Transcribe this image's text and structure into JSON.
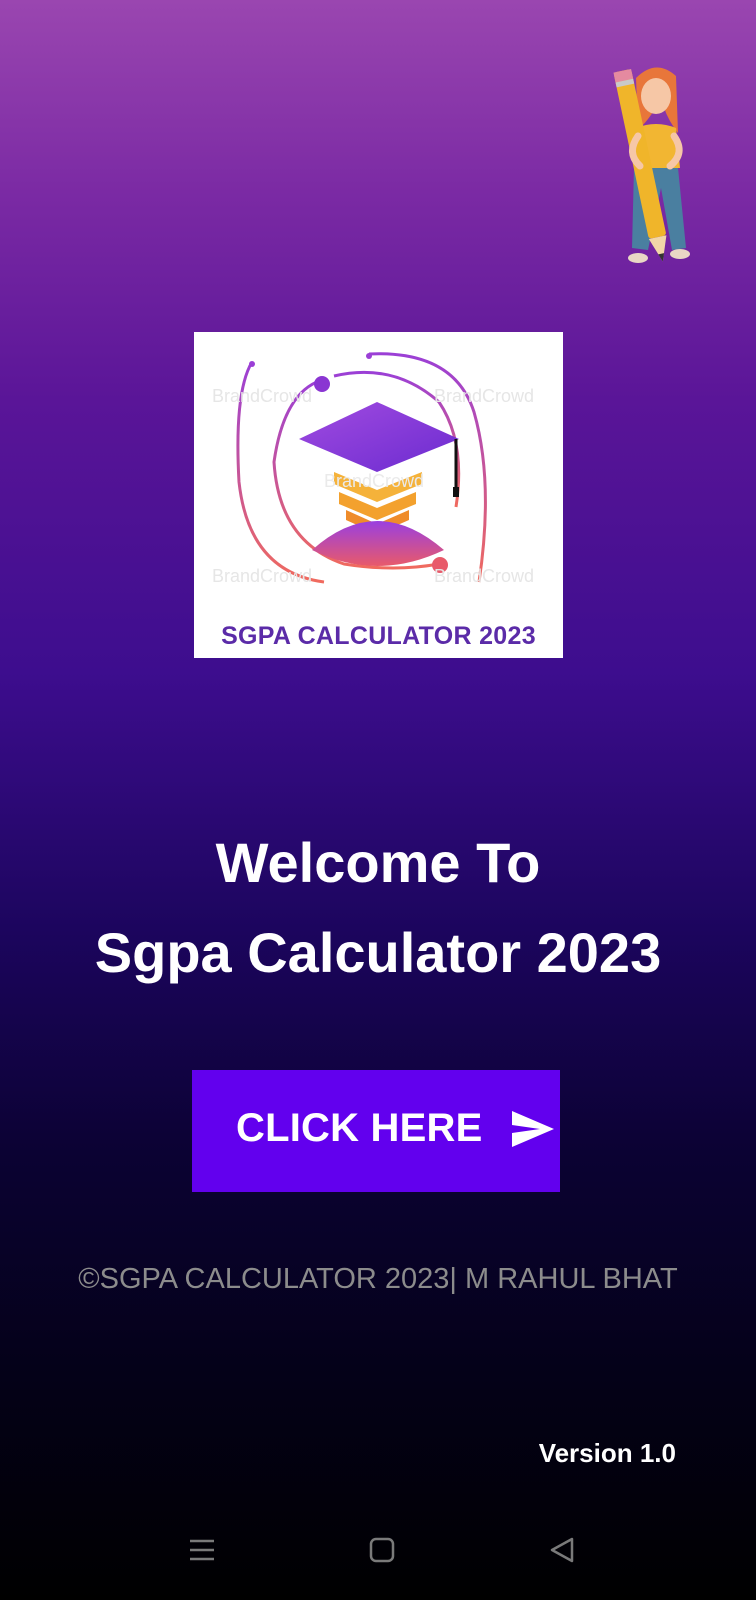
{
  "logo": {
    "title": "SGPA CALCULATOR 2023",
    "watermark": "BrandCrowd",
    "colors": {
      "purple": "#8e44d6",
      "orange": "#f5b23a",
      "red": "#e84a5f"
    }
  },
  "welcome": {
    "line1": "Welcome To",
    "line2": "Sgpa Calculator 2023"
  },
  "cta": {
    "label": "CLICK HERE",
    "icon": "send-icon",
    "color": "#6200ee"
  },
  "footer": {
    "copyright": "©SGPA CALCULATOR 2023| M RAHUL BHAT",
    "version": "Version 1.0"
  },
  "mascot": {
    "icon": "girl-with-pencil-icon"
  },
  "navbar": {
    "items": [
      {
        "icon": "menu-icon"
      },
      {
        "icon": "home-square-icon"
      },
      {
        "icon": "back-triangle-icon"
      }
    ]
  }
}
